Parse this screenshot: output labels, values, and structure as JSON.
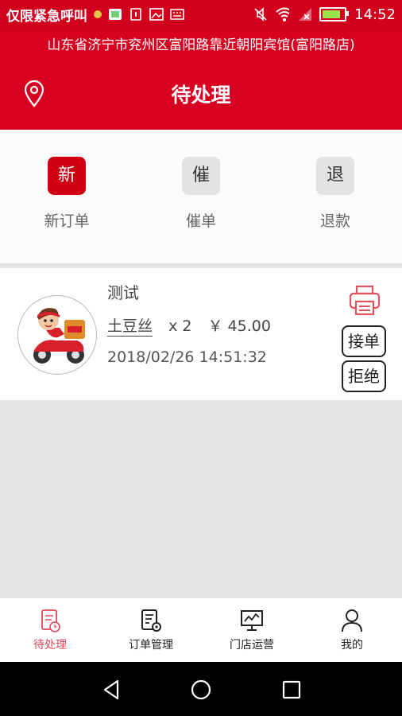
{
  "status_bar": {
    "carrier": "仅限紧急呼叫",
    "time": "14:52",
    "battery_level": 0.85,
    "icons": [
      "notification-dot-icon",
      "app-icon",
      "sim-icon",
      "image-icon",
      "keyboard-icon",
      "mute-icon",
      "wifi-icon",
      "signal-icon",
      "battery-icon"
    ]
  },
  "header": {
    "address": "山东省济宁市兖州区富阳路靠近朝阳宾馆(富阳路店)",
    "title": "待处理",
    "location_icon": "location-icon"
  },
  "quick_actions": [
    {
      "badge": "新",
      "label": "新订单",
      "active": true
    },
    {
      "badge": "催",
      "label": "催单",
      "active": false
    },
    {
      "badge": "退",
      "label": "退款",
      "active": false
    }
  ],
  "order": {
    "name": "测试",
    "item_name": "土豆丝",
    "quantity": "x 2",
    "price": "￥ 45.00",
    "time": "2018/02/26 14:51:32",
    "accept_label": "接单",
    "reject_label": "拒绝",
    "print_icon": "printer-icon"
  },
  "tabs": [
    {
      "label": "待处理",
      "icon": "pending-icon",
      "active": true
    },
    {
      "label": "订单管理",
      "icon": "order-manage-icon",
      "active": false
    },
    {
      "label": "门店运营",
      "icon": "store-stats-icon",
      "active": false
    },
    {
      "label": "我的",
      "icon": "profile-icon",
      "active": false
    }
  ],
  "colors": {
    "brand_red": "#d80020",
    "active_tab": "#e0465a",
    "gray_background": "#e5e5e5"
  }
}
